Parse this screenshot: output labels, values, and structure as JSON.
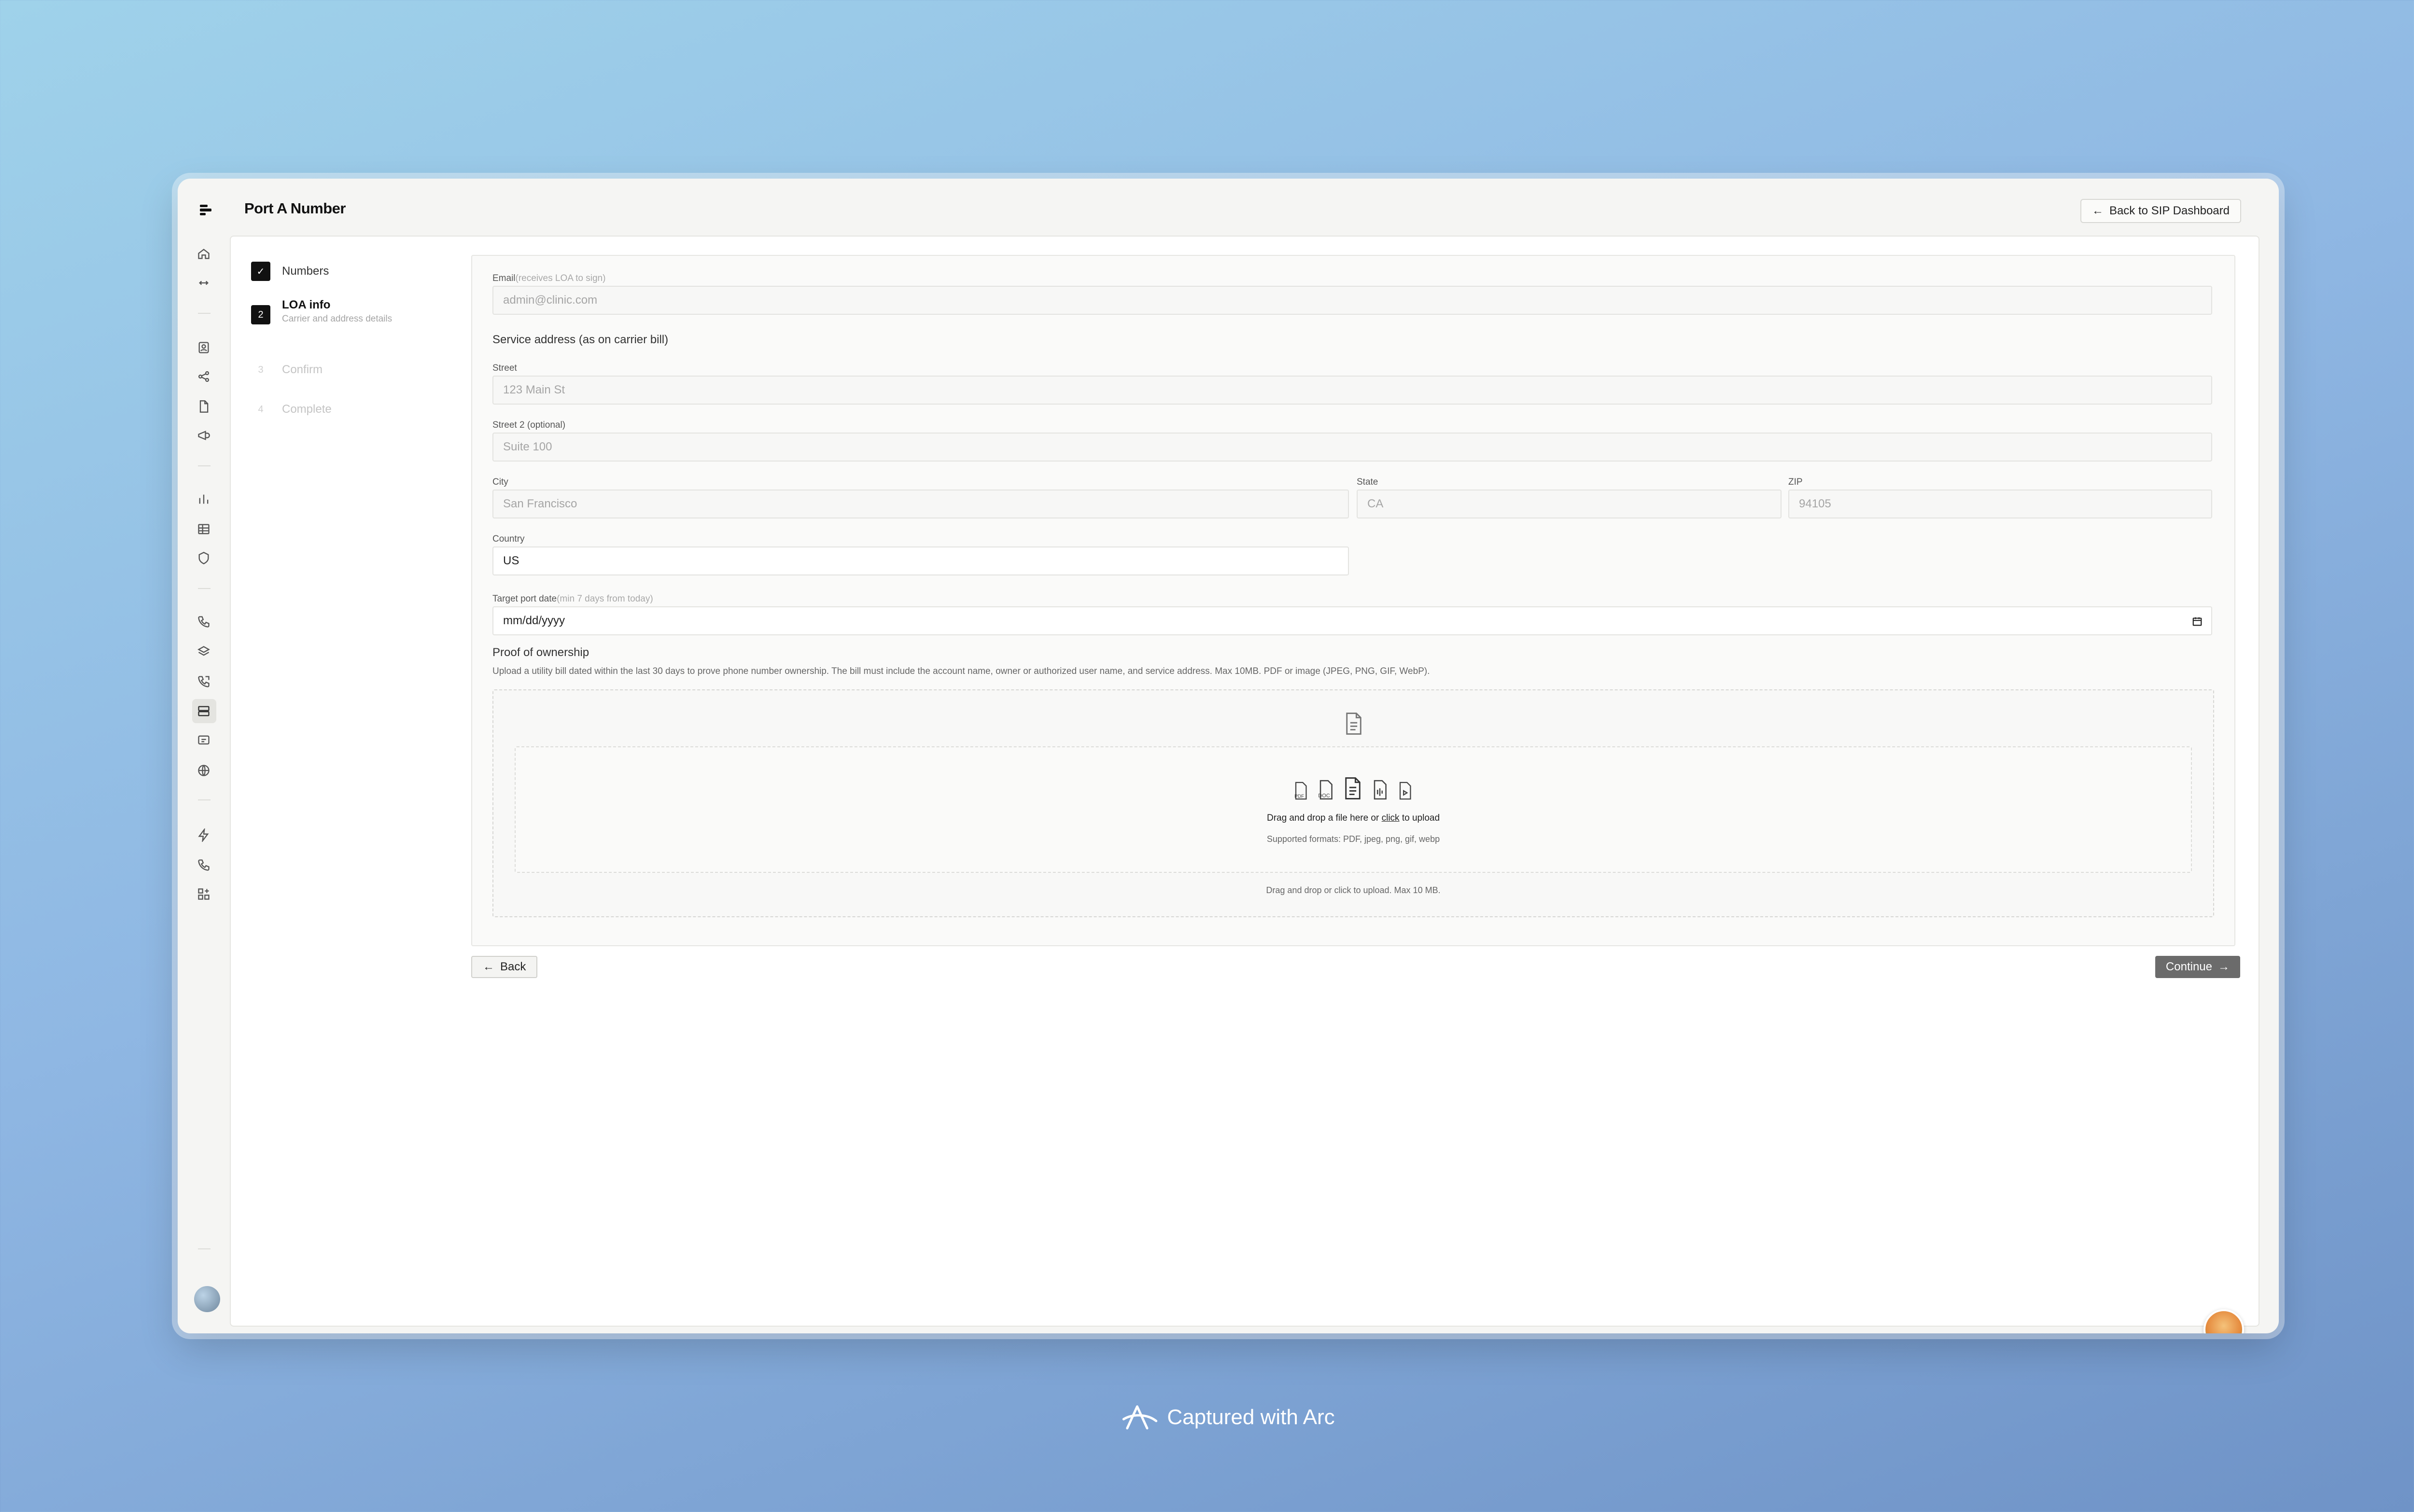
{
  "app": {
    "title": "Port A Number",
    "back_dashboard_label": "Back to SIP Dashboard"
  },
  "rail_icons": [
    "home-icon",
    "collapse-icon",
    "contacts-icon",
    "share-icon",
    "document-icon",
    "megaphone-icon",
    "bar-chart-icon",
    "table-icon",
    "shield-icon",
    "phone-icon",
    "layers-icon",
    "phone-forward-icon",
    "server-icon",
    "message-icon",
    "globe-icon",
    "bolt-icon",
    "phone-flow-icon",
    "apps-icon",
    "book-icon"
  ],
  "steps": [
    {
      "num": "✓",
      "label": "Numbers",
      "sub": "",
      "state": "done"
    },
    {
      "num": "2",
      "label": "LOA info",
      "sub": "Carrier and address details",
      "state": "active"
    },
    {
      "num": "3",
      "label": "Confirm",
      "sub": "",
      "state": "pending"
    },
    {
      "num": "4",
      "label": "Complete",
      "sub": "",
      "state": "pending"
    }
  ],
  "form": {
    "email": {
      "label": "Email",
      "hint": "(receives LOA to sign)",
      "placeholder": "admin@clinic.com"
    },
    "service_address_heading": "Service address (as on carrier bill)",
    "street": {
      "label": "Street",
      "placeholder": "123 Main St"
    },
    "street2": {
      "label": "Street 2 (optional)",
      "placeholder": "Suite 100"
    },
    "city": {
      "label": "City",
      "placeholder": "San Francisco"
    },
    "state": {
      "label": "State",
      "placeholder": "CA"
    },
    "zip": {
      "label": "ZIP",
      "placeholder": "94105"
    },
    "country": {
      "label": "Country",
      "value": "US"
    },
    "target_date": {
      "label": "Target port date",
      "hint": "(min 7 days from today)",
      "value": "mm/dd/yyyy"
    },
    "proof": {
      "heading": "Proof of ownership",
      "description": "Upload a utility bill dated within the last 30 days to prove phone number ownership. The bill must include the account name, owner or authorized user name, and service address. Max 10MB. PDF or image (JPEG, PNG, GIF, WebP).",
      "drop_prefix": "Drag and drop a file here or ",
      "drop_link": "click",
      "drop_suffix": " to upload",
      "formats": "Supported formats: PDF, jpeg, png, gif, webp",
      "footer": "Drag and drop or click to upload. Max 10 MB."
    }
  },
  "buttons": {
    "back": "Back",
    "continue": "Continue"
  },
  "footer_brand": "Captured with Arc"
}
